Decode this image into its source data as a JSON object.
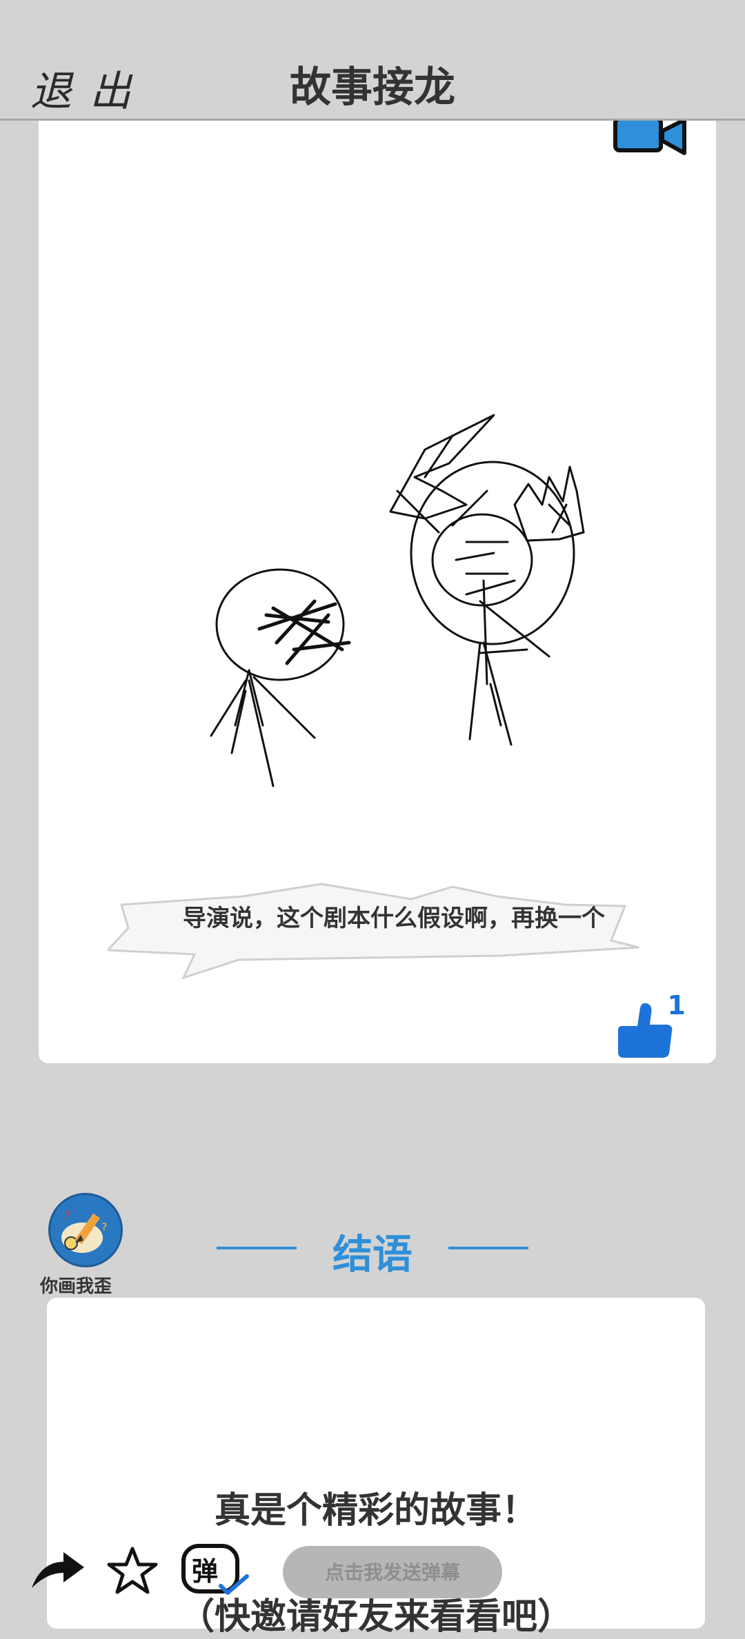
{
  "header": {
    "exit_label": "退出",
    "title": "故事接龙"
  },
  "story": {
    "caption": "导演说，这个剧本什么假设啊，再换一个",
    "like_count": "1",
    "camera_icon": "video-camera-icon",
    "like_icon": "thumbs-up-icon"
  },
  "author": {
    "name": "你画我歪",
    "avatar_icon": "pencil-palette-icon"
  },
  "ending": {
    "heading": "结语",
    "text": "真是个精彩的故事！",
    "text2": "（快邀请好友来看看吧）"
  },
  "toolbar": {
    "share_icon": "share-arrow-icon",
    "favorite_icon": "star-outline-icon",
    "danmaku_icon": "danmaku-toggle-icon",
    "danmaku_placeholder": "点击我发送弹幕"
  },
  "colors": {
    "accent": "#2f8fd8",
    "like": "#1e73d8",
    "background": "#d3d3d3"
  }
}
